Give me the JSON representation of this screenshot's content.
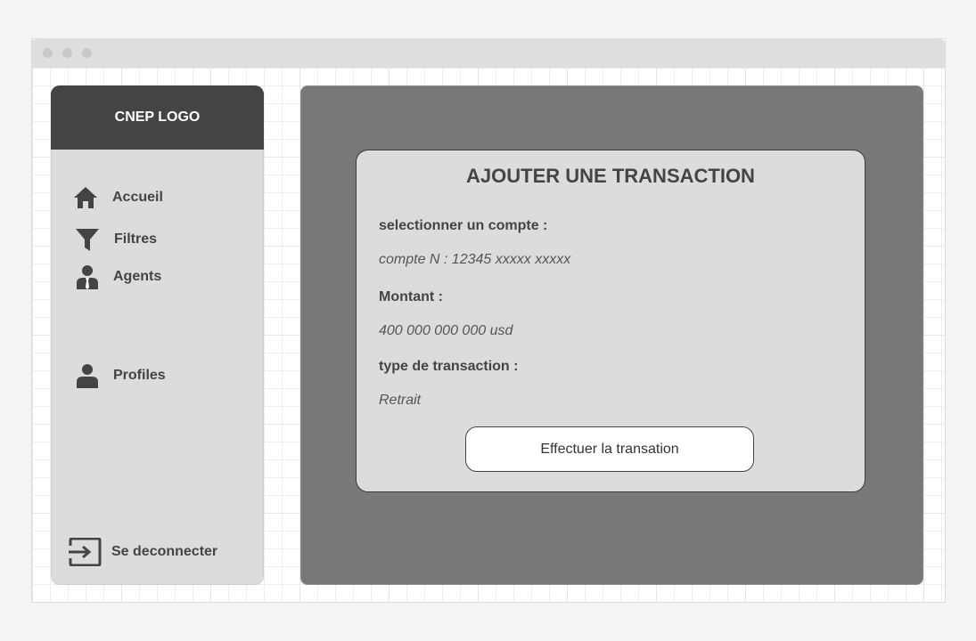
{
  "sidebar": {
    "logo": "CNEP LOGO",
    "items": [
      {
        "label": "Accueil",
        "icon": "home-icon"
      },
      {
        "label": "Filtres",
        "icon": "filter-icon"
      },
      {
        "label": "Agents",
        "icon": "agent-icon"
      },
      {
        "label": "Profiles",
        "icon": "user-icon"
      }
    ],
    "logout": {
      "label": "Se deconnecter",
      "icon": "logout-icon"
    }
  },
  "form": {
    "title": "AJOUTER UNE TRANSACTION",
    "account_label": "selectionner un compte :",
    "account_value": "compte N : 12345 xxxxx xxxxx",
    "amount_label": "Montant :",
    "amount_value": "400 000 000 000 usd",
    "type_label": "type de transaction :",
    "type_value": "Retrait",
    "submit_label": "Effectuer la transation"
  },
  "colors": {
    "sidebar_bg": "#dcdcdc",
    "logo_bg": "#444444",
    "main_bg": "#787878",
    "card_bg": "#dcdcdc",
    "text": "#444444"
  }
}
